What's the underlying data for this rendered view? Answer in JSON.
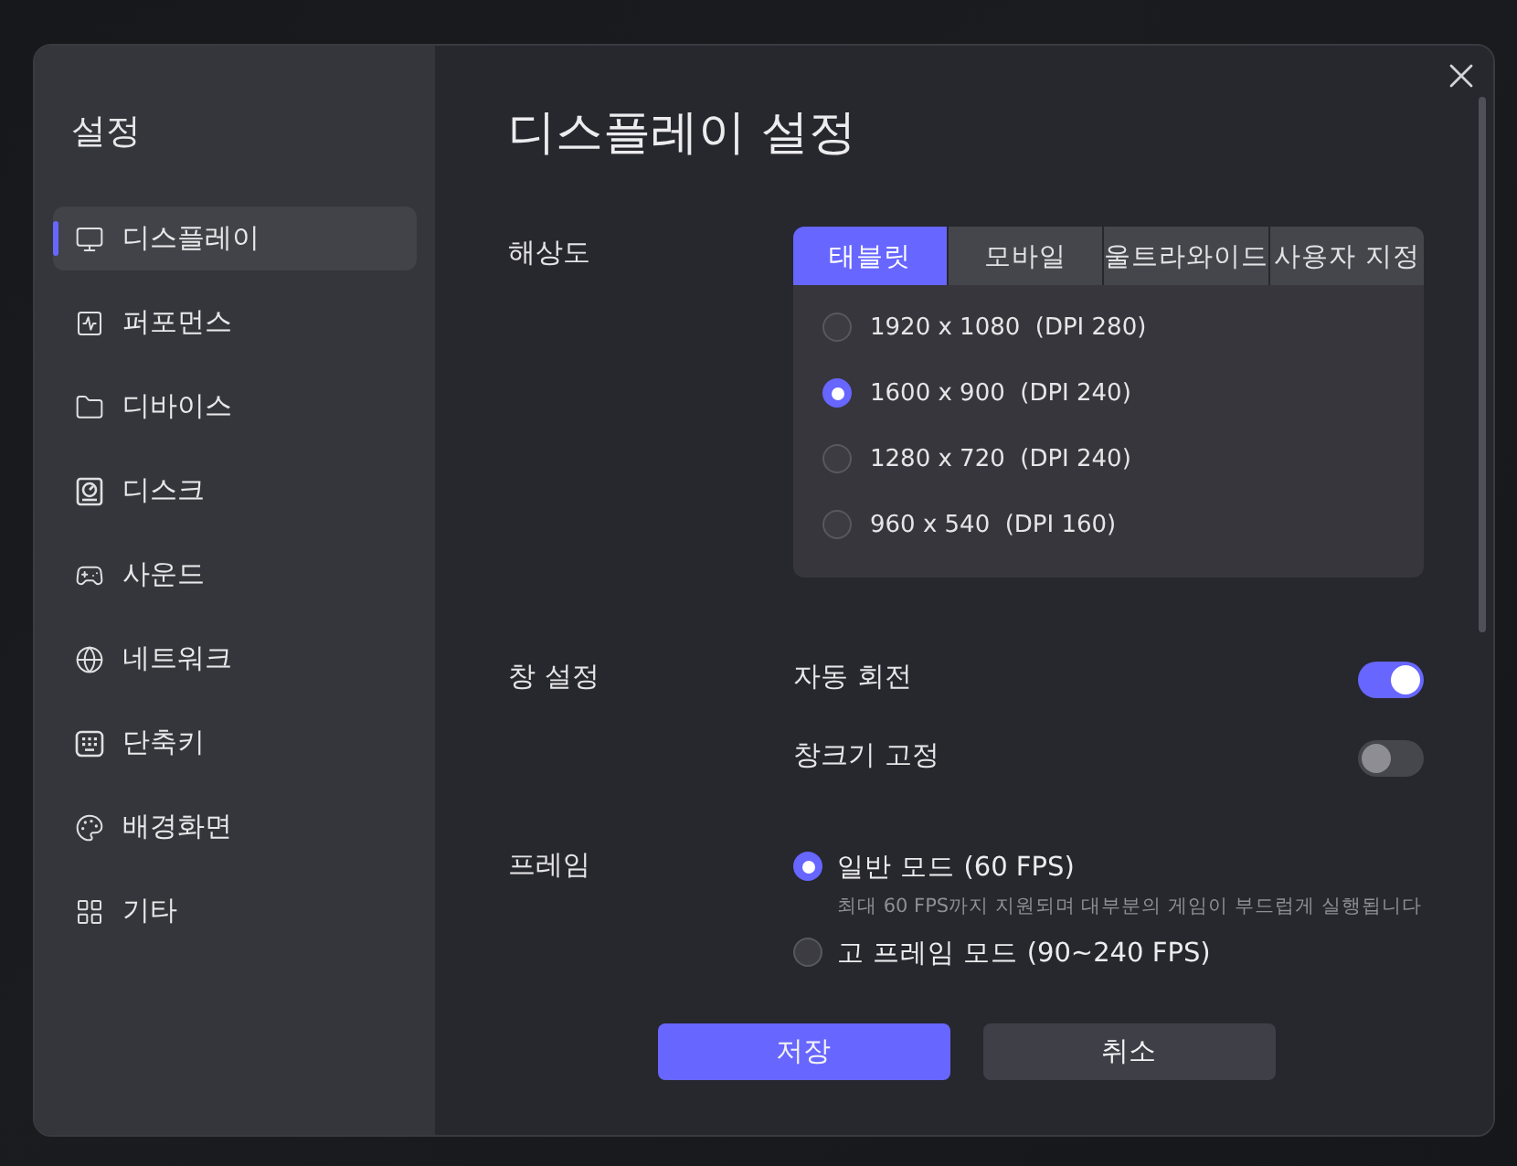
{
  "sidebar": {
    "title": "설정",
    "items": [
      {
        "label": "디스플레이",
        "selected": true
      },
      {
        "label": "퍼포먼스",
        "selected": false
      },
      {
        "label": "디바이스",
        "selected": false
      },
      {
        "label": "디스크",
        "selected": false
      },
      {
        "label": "사운드",
        "selected": false
      },
      {
        "label": "네트워크",
        "selected": false
      },
      {
        "label": "단축키",
        "selected": false
      },
      {
        "label": "배경화면",
        "selected": false
      },
      {
        "label": "기타",
        "selected": false
      }
    ]
  },
  "page": {
    "title": "디스플레이 설정"
  },
  "resolution": {
    "label": "해상도",
    "tabs": [
      {
        "label": "태블릿",
        "selected": true
      },
      {
        "label": "모바일",
        "selected": false
      },
      {
        "label": "울트라와이드",
        "selected": false
      },
      {
        "label": "사용자 지정",
        "selected": false
      }
    ],
    "options": [
      {
        "label": "1920 x 1080  (DPI 280)",
        "selected": false
      },
      {
        "label": "1600 x 900  (DPI 240)",
        "selected": true
      },
      {
        "label": "1280 x 720  (DPI 240)",
        "selected": false
      },
      {
        "label": "960 x 540  (DPI 160)",
        "selected": false
      }
    ]
  },
  "window_settings": {
    "label": "창 설정",
    "toggles": [
      {
        "label": "자동 회전",
        "on": true
      },
      {
        "label": "창크기 고정",
        "on": false
      }
    ]
  },
  "frame": {
    "label": "프레임",
    "options": [
      {
        "label": "일반 모드 (60 FPS)",
        "selected": true,
        "description": "최대 60 FPS까지 지원되며 대부분의 게임이 부드럽게 실행됩니다"
      },
      {
        "label": "고 프레임 모드 (90~240 FPS)",
        "selected": false
      }
    ]
  },
  "buttons": [
    {
      "label": "저장",
      "kind": "primary"
    },
    {
      "label": "취소",
      "kind": "secondary"
    }
  ]
}
